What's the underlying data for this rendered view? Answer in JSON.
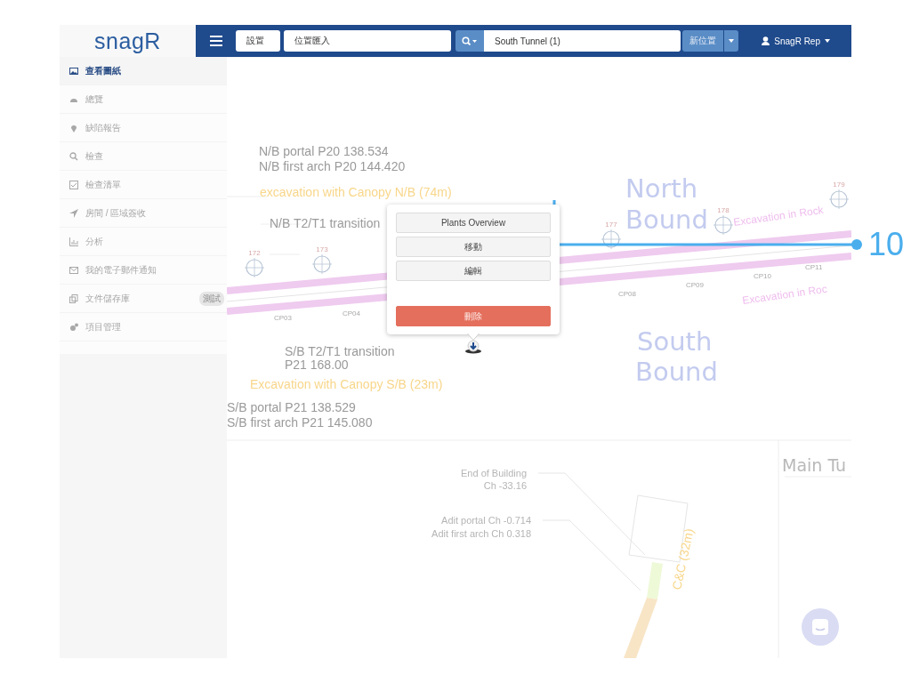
{
  "header": {
    "logo": "snagR",
    "project_button": "設置",
    "import_field": {
      "value": "位置匯入"
    },
    "location_field": {
      "value": "South Tunnel (1)"
    },
    "new_location_button": "新位置",
    "user": "SnagR Rep"
  },
  "sidebar": {
    "items": [
      {
        "label": "查看圖紙",
        "selected": true
      },
      {
        "label": "總覽",
        "selected": false
      },
      {
        "label": "缺陷報告",
        "selected": false
      },
      {
        "label": "檢查",
        "selected": false
      },
      {
        "label": "檢查清單",
        "selected": false
      },
      {
        "label": "房間 / 區域簽收",
        "selected": false
      },
      {
        "label": "分析",
        "selected": false
      },
      {
        "label": "我的電子郵件通知",
        "selected": false
      },
      {
        "label": "文件儲存庫",
        "selected": false,
        "badge": "測試"
      },
      {
        "label": "項目管理",
        "selected": false
      }
    ]
  },
  "drawing": {
    "labels": [
      {
        "text": "N/B portal P20 138.534",
        "kind": "note"
      },
      {
        "text": "N/B first arch P20 144.420",
        "kind": "note"
      },
      {
        "text": "excavation with Canopy N/B  (74m)",
        "kind": "canopy"
      },
      {
        "text": "N/B T2/T1 transition",
        "kind": "note"
      },
      {
        "text": "North",
        "kind": "heading"
      },
      {
        "text": "Bound",
        "kind": "heading"
      },
      {
        "text": "Excavation in Rock",
        "kind": "rock"
      },
      {
        "text": "Excavation in Roc",
        "kind": "rock"
      },
      {
        "text": "CP03",
        "kind": "chainage"
      },
      {
        "text": "CP04",
        "kind": "chainage"
      },
      {
        "text": "CP08",
        "kind": "chainage"
      },
      {
        "text": "CP09",
        "kind": "chainage"
      },
      {
        "text": "CP10",
        "kind": "chainage"
      },
      {
        "text": "CP11",
        "kind": "chainage"
      },
      {
        "text": "South",
        "kind": "heading"
      },
      {
        "text": "Bound",
        "kind": "heading"
      },
      {
        "text": "S/B T2/T1 transition",
        "kind": "note"
      },
      {
        "text": "P21 168.00",
        "kind": "note"
      },
      {
        "text": "Excavation with Canopy S/B (23m)",
        "kind": "canopy"
      },
      {
        "text": "S/B portal P21 138.529",
        "kind": "note"
      },
      {
        "text": "S/B first arch P21 145.080",
        "kind": "note"
      },
      {
        "text": "End of Building",
        "kind": "callout"
      },
      {
        "text": "Ch -33.16",
        "kind": "callout"
      },
      {
        "text": "Adit portal Ch -0.714",
        "kind": "callout"
      },
      {
        "text": "Adit first arch Ch 0.318",
        "kind": "callout"
      },
      {
        "text": "C&C (32m)",
        "kind": "canopy"
      },
      {
        "text": "Main Tu",
        "kind": "title"
      }
    ],
    "markers": [
      {
        "label": "172"
      },
      {
        "label": "173"
      },
      {
        "label": "177"
      },
      {
        "label": "178"
      },
      {
        "label": "179"
      }
    ]
  },
  "popup": {
    "buttons": [
      {
        "label": "Plants Overview",
        "kind": "default"
      },
      {
        "label": "移動",
        "kind": "default"
      },
      {
        "label": "編輯",
        "kind": "default"
      },
      {
        "label": "刪除",
        "kind": "danger"
      }
    ]
  },
  "measure": {
    "label": "10"
  }
}
